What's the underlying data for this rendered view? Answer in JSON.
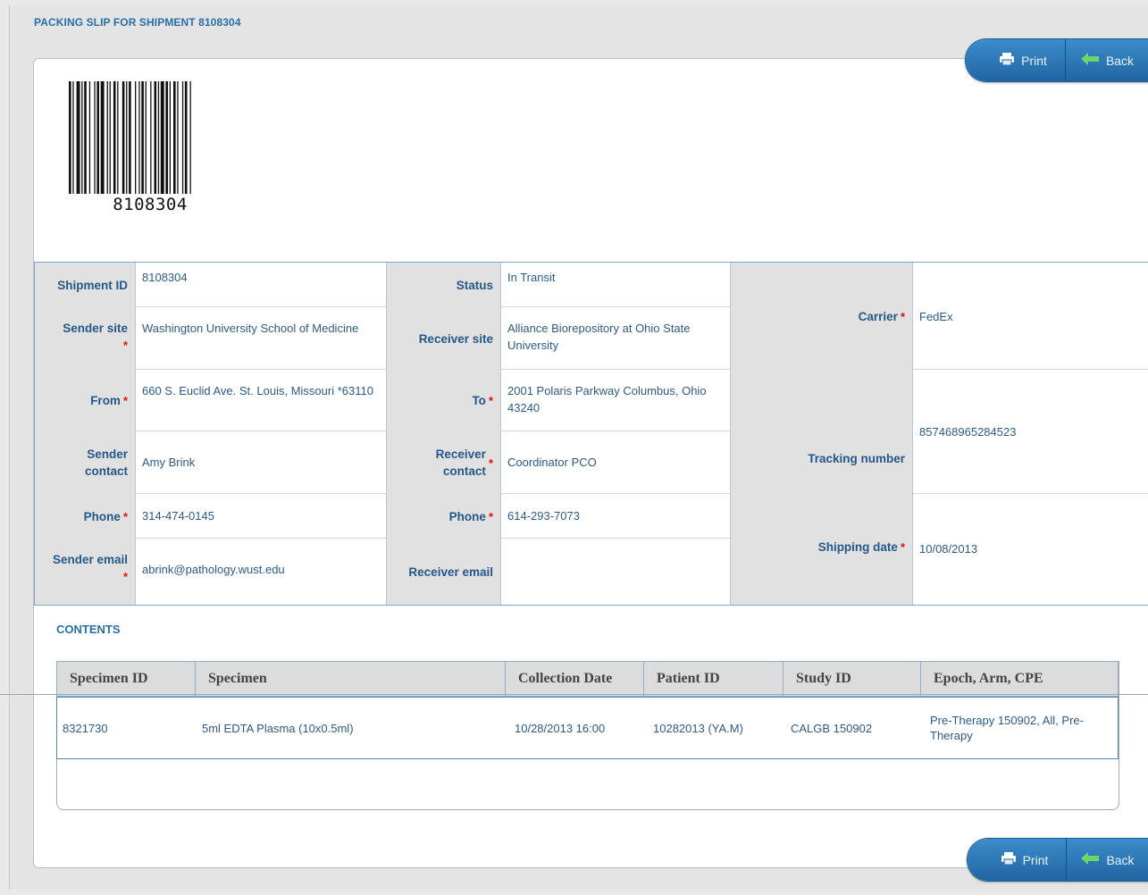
{
  "page": {
    "title": "PACKING SLIP FOR SHIPMENT 8108304"
  },
  "actions": {
    "print_label": "Print",
    "back_label": "Back",
    "print_icon": "printer-icon",
    "back_icon": "arrow-left-icon"
  },
  "barcode": {
    "number": "8108304"
  },
  "shipment": {
    "shipment_id": {
      "label": "Shipment ID",
      "value": "8108304"
    },
    "sender_site": {
      "label": "Sender site",
      "value": "Washington University School of Medicine"
    },
    "from": {
      "label": "From",
      "value": "660 S. Euclid Ave. St. Louis, Missouri *63110"
    },
    "sender_contact": {
      "label": "Sender contact",
      "value": "Amy Brink"
    },
    "sender_phone": {
      "label": "Phone",
      "value": "314-474-0145"
    },
    "sender_email": {
      "label": "Sender email",
      "value": "abrink@pathology.wust.edu"
    },
    "status": {
      "label": "Status",
      "value": "In Transit"
    },
    "receiver_site": {
      "label": "Receiver site",
      "value": "Alliance Biorepository at Ohio State University"
    },
    "to": {
      "label": "To",
      "value": "2001 Polaris Parkway Columbus, Ohio 43240"
    },
    "receiver_contact": {
      "label": "Receiver contact",
      "value": "Coordinator PCO"
    },
    "receiver_phone": {
      "label": "Phone",
      "value": "614-293-7073"
    },
    "receiver_email": {
      "label": "Receiver email",
      "value": ""
    },
    "carrier": {
      "label": "Carrier",
      "value": "FedEx"
    },
    "tracking_number": {
      "label": "Tracking number",
      "value": "857468965284523"
    },
    "shipping_date": {
      "label": "Shipping date",
      "value": "10/08/2013"
    },
    "required_mark": "*"
  },
  "contents": {
    "title": "CONTENTS",
    "columns": [
      "Specimen ID",
      "Specimen",
      "Collection Date",
      "Patient ID",
      "Study ID",
      "Epoch, Arm, CPE"
    ],
    "rows": [
      [
        "8321730",
        "5ml EDTA Plasma (10x0.5ml)",
        "10/28/2013 16:00",
        "10282013 (YA.M)",
        "CALGB 150902",
        "Pre-Therapy 150902, All, Pre-Therapy"
      ]
    ]
  }
}
